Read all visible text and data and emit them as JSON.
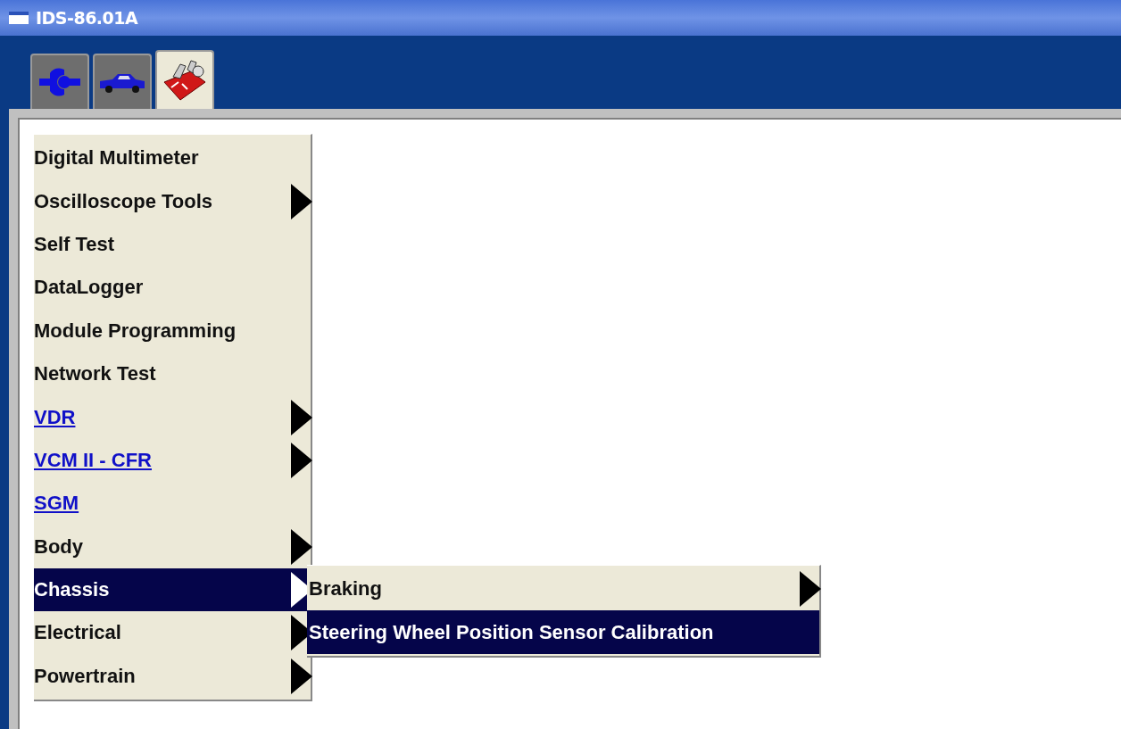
{
  "window": {
    "title": "IDS-86.01A"
  },
  "tabs": [
    {
      "kind": "connector",
      "selected": false
    },
    {
      "kind": "vehicle",
      "selected": false
    },
    {
      "kind": "toolbox",
      "selected": true
    }
  ],
  "menu": {
    "items": [
      {
        "label": "Digital Multimeter",
        "kind": "plain",
        "submenu": false,
        "selected": false
      },
      {
        "label": "Oscilloscope Tools",
        "kind": "plain",
        "submenu": true,
        "selected": false
      },
      {
        "label": "Self Test",
        "kind": "plain",
        "submenu": false,
        "selected": false
      },
      {
        "label": "DataLogger",
        "kind": "plain",
        "submenu": false,
        "selected": false
      },
      {
        "label": "Module Programming",
        "kind": "plain",
        "submenu": false,
        "selected": false
      },
      {
        "label": "Network Test",
        "kind": "plain",
        "submenu": false,
        "selected": false
      },
      {
        "label": "VDR",
        "kind": "link",
        "submenu": true,
        "selected": false
      },
      {
        "label": "VCM II - CFR",
        "kind": "link",
        "submenu": true,
        "selected": false
      },
      {
        "label": "SGM",
        "kind": "link",
        "submenu": false,
        "selected": false
      },
      {
        "label": "Body",
        "kind": "plain",
        "submenu": true,
        "selected": false
      },
      {
        "label": "Chassis",
        "kind": "plain",
        "submenu": true,
        "selected": true
      },
      {
        "label": "Electrical",
        "kind": "plain",
        "submenu": true,
        "selected": false
      },
      {
        "label": "Powertrain",
        "kind": "plain",
        "submenu": true,
        "selected": false
      }
    ]
  },
  "submenu": {
    "items": [
      {
        "label": "Braking",
        "submenu": true,
        "selected": false
      },
      {
        "label": "Steering Wheel Position Sensor Calibration",
        "submenu": false,
        "selected": true
      }
    ]
  }
}
